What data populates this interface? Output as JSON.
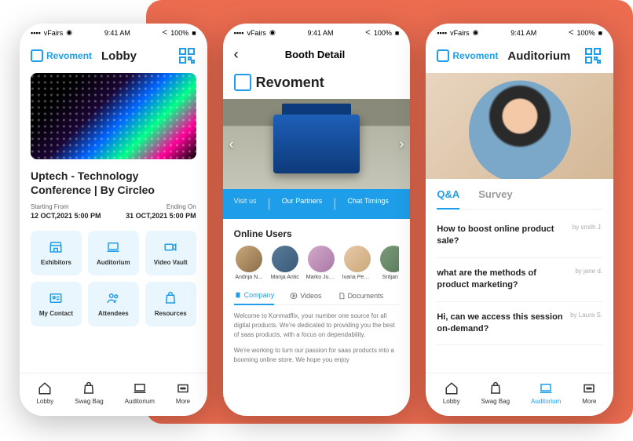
{
  "status": {
    "carrier": "vFairs",
    "time": "9:41 AM",
    "battery": "100%",
    "signal": "▪▪▪▪",
    "wifi": "◉"
  },
  "brand": "Revoment",
  "phone1": {
    "title": "Lobby",
    "event_title": "Uptech - Technology Conference | By Circleo",
    "start_label": "Starting From",
    "start_val": "12 OCT,2021   5:00 PM",
    "end_label": "Ending On",
    "end_val": "31 OCT,2021   5:00 PM",
    "cards": [
      "Exhibitors",
      "Auditorium",
      "Video Vault",
      "My Contact",
      "Attendees",
      "Resources"
    ],
    "nav": [
      "Lobby",
      "Swag Bag",
      "Auditorium",
      "More"
    ]
  },
  "phone2": {
    "title": "Booth Detail",
    "brand": "Revoment",
    "actions": [
      "Visit us",
      "Our Partners",
      "Chat Timings"
    ],
    "online_title": "Online Users",
    "users": [
      "Andrija N...",
      "Marija Antic",
      "Marko Jus...",
      "Ivana Pesi...",
      "Srdjan ..."
    ],
    "tabs": [
      "Company",
      "Videos",
      "Documents"
    ],
    "desc1": "Welcome to Konmatflix, your number one source for all digital products. We're dedicated to providing you the best of saas products, with a focus on dependability.",
    "desc2": "We're working to turn our passion for saas products into a booming online store. We hope you enjoy"
  },
  "phone3": {
    "title": "Auditorium",
    "tabs": [
      "Q&A",
      "Survey"
    ],
    "qa": [
      {
        "q": "How to boost online product sale?",
        "a": "by smith J."
      },
      {
        "q": "what are the methods of product marketing?",
        "a": "by jane d."
      },
      {
        "q": "Hi, can we access this session on-demand?",
        "a": "by Laura S."
      }
    ],
    "nav": [
      "Lobby",
      "Swag Bag",
      "Auditorium",
      "More"
    ]
  }
}
